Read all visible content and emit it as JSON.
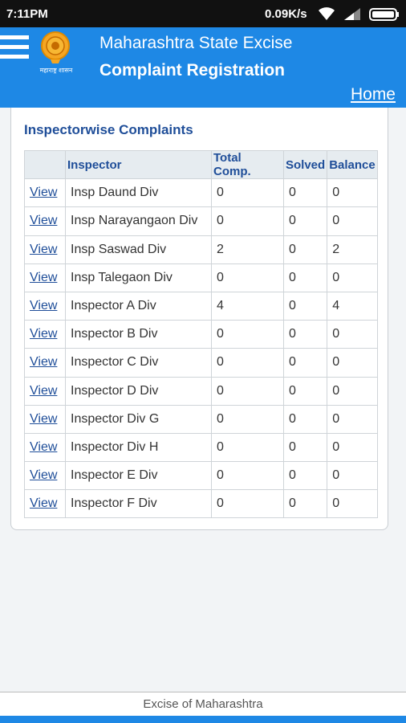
{
  "status_bar": {
    "time": "7:11PM",
    "network_speed": "0.09K/s"
  },
  "header": {
    "logo_text": "महाराष्ट्र शासन",
    "title": "Maharashtra State Excise",
    "subtitle": "Complaint Registration",
    "home_label": "Home"
  },
  "panel": {
    "title": "Inspectorwise Complaints"
  },
  "table": {
    "headers": [
      "",
      "Inspector",
      "Total Comp.",
      "Solved",
      "Balance"
    ],
    "rows": [
      {
        "action": "View",
        "inspector": "Insp Daund Div",
        "total": "0",
        "solved": "0",
        "balance": "0"
      },
      {
        "action": "View",
        "inspector": "Insp Narayangaon Div",
        "total": "0",
        "solved": "0",
        "balance": "0"
      },
      {
        "action": "View",
        "inspector": "Insp Saswad Div",
        "total": "2",
        "solved": "0",
        "balance": "2"
      },
      {
        "action": "View",
        "inspector": "Insp Talegaon Div",
        "total": "0",
        "solved": "0",
        "balance": "0"
      },
      {
        "action": "View",
        "inspector": "Inspector A Div",
        "total": "4",
        "solved": "0",
        "balance": "4"
      },
      {
        "action": "View",
        "inspector": "Inspector B Div",
        "total": "0",
        "solved": "0",
        "balance": "0"
      },
      {
        "action": "View",
        "inspector": "Inspector C Div",
        "total": "0",
        "solved": "0",
        "balance": "0"
      },
      {
        "action": "View",
        "inspector": "Inspector D Div",
        "total": "0",
        "solved": "0",
        "balance": "0"
      },
      {
        "action": "View",
        "inspector": "Inspector Div G",
        "total": "0",
        "solved": "0",
        "balance": "0"
      },
      {
        "action": "View",
        "inspector": "Inspector Div H",
        "total": "0",
        "solved": "0",
        "balance": "0"
      },
      {
        "action": "View",
        "inspector": "Inspector E Div",
        "total": "0",
        "solved": "0",
        "balance": "0"
      },
      {
        "action": "View",
        "inspector": "Inspector F Div",
        "total": "0",
        "solved": "0",
        "balance": "0"
      }
    ]
  },
  "footer": {
    "text": "Excise of Maharashtra"
  },
  "colors": {
    "primary": "#1e88e5",
    "link": "#1f4e99",
    "emblem": "#f5a623"
  }
}
